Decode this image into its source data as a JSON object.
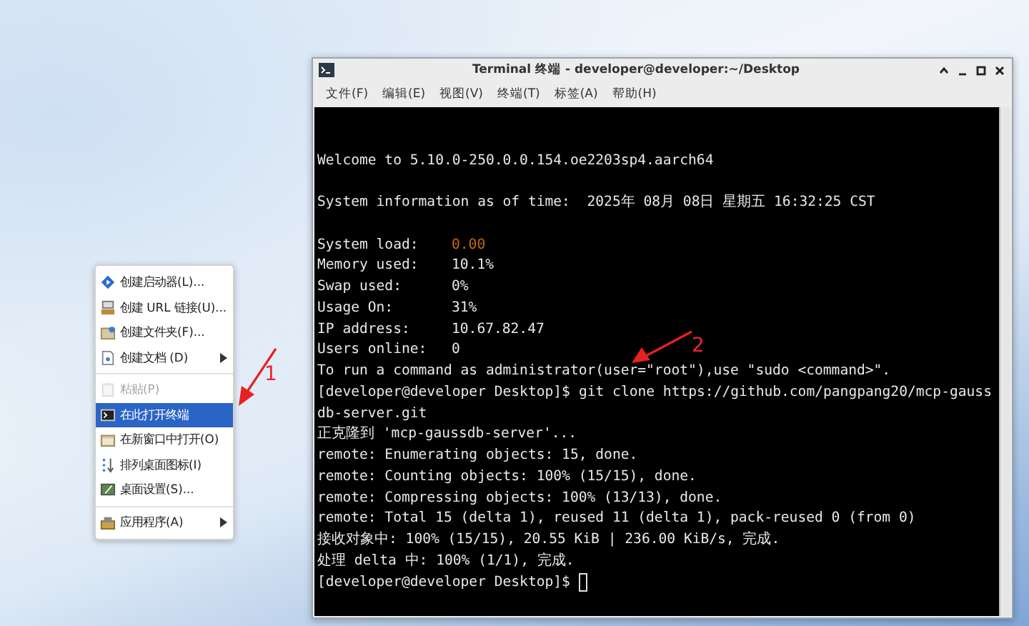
{
  "context_menu": {
    "groups": [
      [
        {
          "label": "创建启动器(L)...",
          "disabled": false,
          "selected": false,
          "submenu": false
        },
        {
          "label": "创建 URL 链接(U)...",
          "disabled": false,
          "selected": false,
          "submenu": false
        },
        {
          "label": "创建文件夹(F)...",
          "disabled": false,
          "selected": false,
          "submenu": false
        },
        {
          "label": "创建文档 (D)",
          "disabled": false,
          "selected": false,
          "submenu": true
        }
      ],
      [
        {
          "label": "粘贴(P)",
          "disabled": true,
          "selected": false,
          "submenu": false
        },
        {
          "label": "在此打开终端",
          "disabled": false,
          "selected": true,
          "submenu": false
        },
        {
          "label": "在新窗口中打开(O)",
          "disabled": false,
          "selected": false,
          "submenu": false
        },
        {
          "label": "排列桌面图标(I)",
          "disabled": false,
          "selected": false,
          "submenu": false
        },
        {
          "label": "桌面设置(S)...",
          "disabled": false,
          "selected": false,
          "submenu": false
        }
      ],
      [
        {
          "label": "应用程序(A)",
          "disabled": false,
          "selected": false,
          "submenu": true
        }
      ]
    ]
  },
  "annotations": [
    {
      "label": "1"
    },
    {
      "label": "2"
    }
  ],
  "window": {
    "title": "Terminal 终端 - developer@developer:~/Desktop",
    "menu": [
      "文件(F)",
      "编辑(E)",
      "视图(V)",
      "终端(T)",
      "标签(A)",
      "帮助(H)"
    ],
    "lines": [
      {
        "kind": "blank"
      },
      {
        "kind": "blank"
      },
      {
        "kind": "text",
        "text": "Welcome to 5.10.0-250.0.0.154.oe2203sp4.aarch64"
      },
      {
        "kind": "blank"
      },
      {
        "kind": "text",
        "text": "System information as of time:  2025年 08月 08日 星期五 16:32:25 CST"
      },
      {
        "kind": "blank"
      },
      {
        "kind": "field",
        "label": "System load:",
        "value": "0.00",
        "highlight": true
      },
      {
        "kind": "field",
        "label": "Memory used:",
        "value": "10.1%",
        "highlight": false
      },
      {
        "kind": "field",
        "label": "Swap used:",
        "value": "0%",
        "highlight": false
      },
      {
        "kind": "field",
        "label": "Usage On:",
        "value": "31%",
        "highlight": false
      },
      {
        "kind": "field",
        "label": "IP address:",
        "value": "10.67.82.47",
        "highlight": false
      },
      {
        "kind": "field",
        "label": "Users online:",
        "value": "0",
        "highlight": false
      },
      {
        "kind": "text",
        "text": "To run a command as administrator(user=\"root\"),use \"sudo <command>\"."
      },
      {
        "kind": "prompt",
        "prompt": "[developer@developer Desktop]$",
        "command": "git clone https://github.com/pangpang20/mcp-gauss",
        "cursor": false
      },
      {
        "kind": "text",
        "text": "db-server.git"
      },
      {
        "kind": "text",
        "text": "正克隆到 'mcp-gaussdb-server'..."
      },
      {
        "kind": "text",
        "text": "remote: Enumerating objects: 15, done."
      },
      {
        "kind": "text",
        "text": "remote: Counting objects: 100% (15/15), done."
      },
      {
        "kind": "text",
        "text": "remote: Compressing objects: 100% (13/13), done."
      },
      {
        "kind": "text",
        "text": "remote: Total 15 (delta 1), reused 11 (delta 1), pack-reused 0 (from 0)"
      },
      {
        "kind": "text",
        "text": "接收对象中: 100% (15/15), 20.55 KiB | 236.00 KiB/s, 完成."
      },
      {
        "kind": "text",
        "text": "处理 delta 中: 100% (1/1), 完成."
      },
      {
        "kind": "prompt",
        "prompt": "[developer@developer Desktop]$",
        "cursor": true
      }
    ]
  }
}
